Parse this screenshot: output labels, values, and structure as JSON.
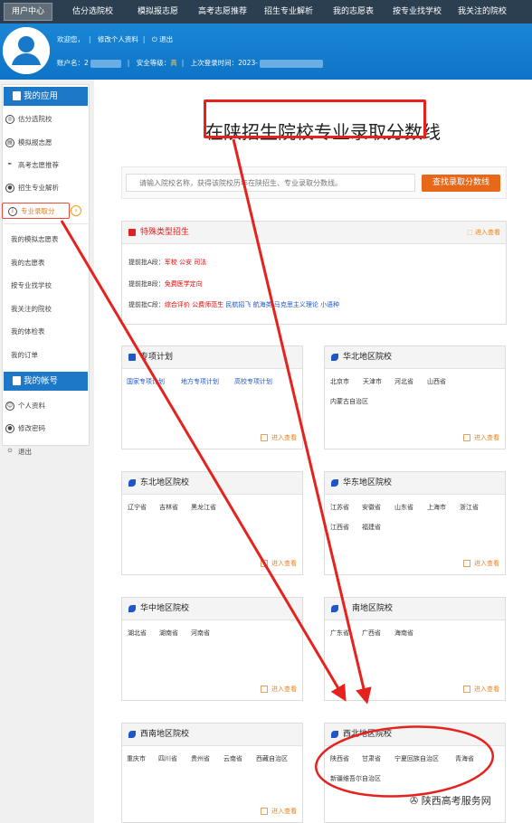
{
  "nav": {
    "items": [
      "用户中心",
      "估分选院校",
      "模拟报志愿",
      "高考志愿推荐",
      "招生专业解析",
      "我的志愿表",
      "按专业找学校",
      "我关注的院校"
    ]
  },
  "profile": {
    "welcome": "欢迎您，",
    "edit": "修改个人资料",
    "logout": "退出",
    "account_label": "账户名：",
    "account_value": "2",
    "security_label": "安全等级：",
    "security_value": "高",
    "last_login_label": "上次登录时间：",
    "last_login_value": "2023-"
  },
  "sidebar": {
    "apps_title": "我的应用",
    "apps": [
      "估分选院校",
      "模拟报志愿",
      "高考志愿推荐",
      "招生专业解析",
      "专业录取分"
    ],
    "links": [
      "我的模拟志愿表",
      "我的志愿表",
      "按专业找学校",
      "我关注的院校",
      "我的体检表",
      "我的订单"
    ],
    "account_title": "我的帐号",
    "account_items": [
      "个人资料",
      "修改密码",
      "退出"
    ]
  },
  "main": {
    "title": "在陕招生院校专业录取分数线",
    "search_placeholder": "请输入院校名称，获得该院校历年在陕招生、专业录取分数线。",
    "search_button": "查找录取分数线",
    "more": "进入查看"
  },
  "special": {
    "title": "特殊类型招生",
    "a_label": "提前批A段：",
    "a_items": [
      "军校",
      "公安",
      "司法"
    ],
    "b_label": "提前批B段：",
    "b_items": [
      "免费医学定向"
    ],
    "c_label": "提前批C段：",
    "c_items": [
      "综合评价",
      "公费师范生",
      "民航招飞",
      "航海类",
      "马克思主义理论",
      "小语种"
    ]
  },
  "cards": [
    {
      "title": "专项计划",
      "items": [
        "国家专项计划",
        "地方专项计划",
        "高校专项计划"
      ]
    },
    {
      "title": "华北地区院校",
      "items": [
        "北京市",
        "天津市",
        "河北省",
        "山西省",
        "内蒙古自治区"
      ]
    },
    {
      "title": "东北地区院校",
      "items": [
        "辽宁省",
        "吉林省",
        "黑龙江省"
      ]
    },
    {
      "title": "华东地区院校",
      "items": [
        "江苏省",
        "安徽省",
        "山东省",
        "上海市",
        "浙江省",
        "江西省",
        "福建省"
      ]
    },
    {
      "title": "华中地区院校",
      "items": [
        "湖北省",
        "湖南省",
        "河南省"
      ]
    },
    {
      "title": "南地区院校",
      "items": [
        "广东省",
        "广西省",
        "海南省"
      ]
    },
    {
      "title": "西南地区院校",
      "items": [
        "重庆市",
        "四川省",
        "贵州省",
        "云南省",
        "西藏自治区"
      ]
    },
    {
      "title": "西北地区院校",
      "items": [
        "陕西省",
        "甘肃省",
        "宁夏回族自治区",
        "青海省",
        "新疆维吾尔自治区"
      ]
    }
  ],
  "watermark": "陕西高考服务网",
  "colors": {
    "nav": "#2c3f51",
    "profile": "#1b86d6",
    "sidebar_head": "#1e78c8",
    "accent": "#e8681a",
    "annotation": "#e5221d"
  }
}
